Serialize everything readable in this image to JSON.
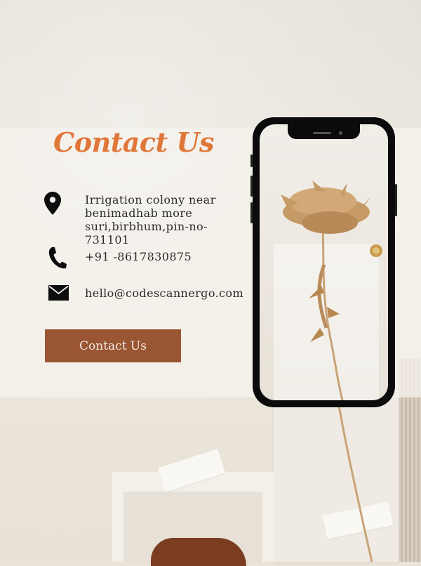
{
  "contact": {
    "heading": "Contact Us",
    "address_lines": [
      "Irrigation colony near",
      "benimadhab more",
      "suri,birbhum,pin-no-",
      "731101"
    ],
    "phone": "+91 -8617830875",
    "email": "hello@codescannergo.com",
    "button_label": "Contact Us"
  },
  "icons": {
    "location": "map-pin-icon",
    "phone": "phone-icon",
    "email": "envelope-icon"
  },
  "colors": {
    "heading": "#e0773a",
    "button_bg": "#9a5533",
    "button_text": "#f4ece4",
    "text": "#2b2b2b",
    "phone_frame": "#0b0b0b"
  }
}
